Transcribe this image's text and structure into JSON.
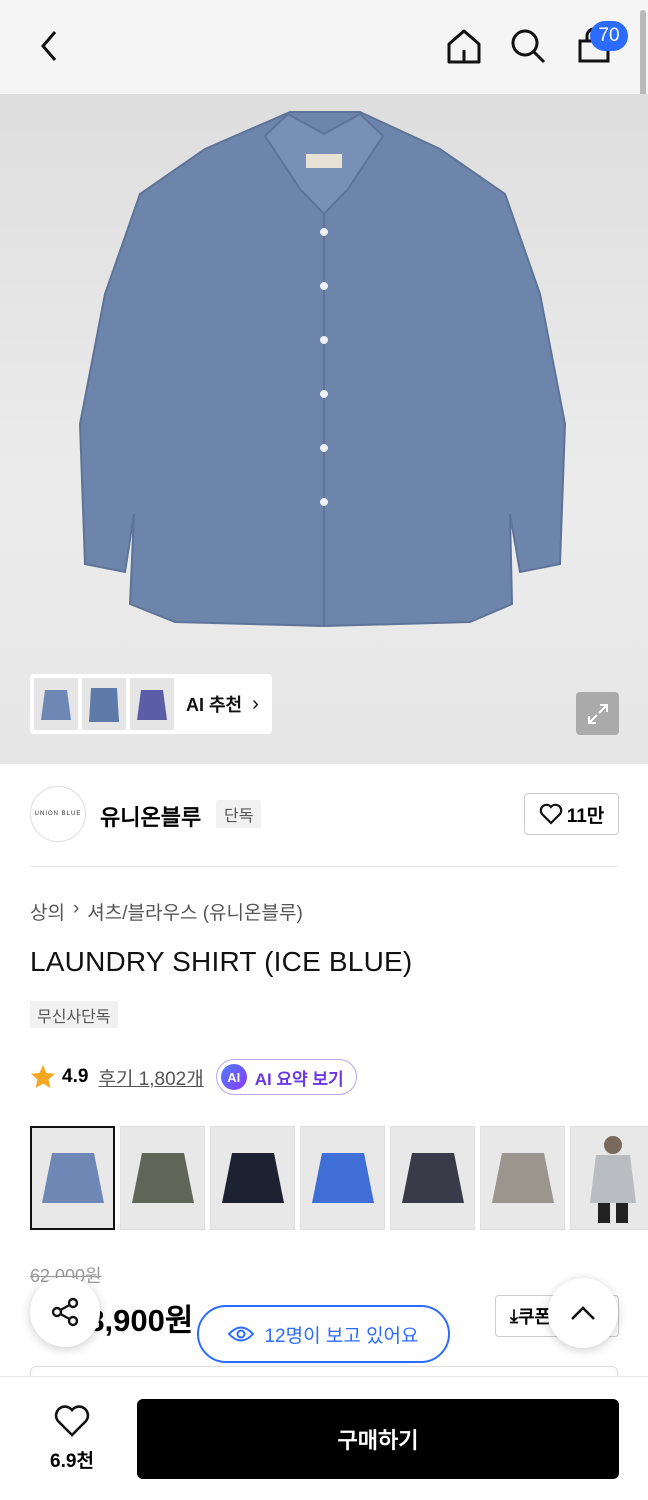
{
  "header": {
    "back_icon": "chevron-left-icon",
    "home_icon": "home-icon",
    "search_icon": "search-icon",
    "cart_icon": "shopping-bag-icon",
    "cart_count": "70",
    "badge_color": "#2c6bff"
  },
  "hero": {
    "product_color": "#6d84ab",
    "ai_recommend_label": "AI 추천",
    "expand_icon": "expand-icon"
  },
  "brand": {
    "logo_text": "UNION BLUE",
    "name": "유니온블루",
    "tag": "단독",
    "likes": "11만"
  },
  "product": {
    "breadcrumb": [
      "상의",
      "셔츠/블라우스 (유니온블루)"
    ],
    "title": "LAUNDRY SHIRT (ICE BLUE)",
    "tag": "무신사단독",
    "rating": "4.9",
    "review_label": "후기 1,802개",
    "ai_badge": "AI",
    "ai_summary_label": "AI 요약 보기"
  },
  "swatches": [
    {
      "color": "#6f87b4",
      "selected": true
    },
    {
      "color": "#5f6657",
      "selected": false
    },
    {
      "color": "#1d2233",
      "selected": false
    },
    {
      "color": "#3f6fd6",
      "selected": false
    },
    {
      "color": "#3b3a48",
      "selected": false
    },
    {
      "color": "#9a958d",
      "selected": false
    },
    {
      "color": "#b9bcc0",
      "selected": false
    }
  ],
  "price": {
    "original": "62,000원",
    "current": "58,900원",
    "coupon_label": "쿠폰"
  },
  "viewers": {
    "label": "12명이 보고 있어요"
  },
  "bottom_bar": {
    "wish_count": "6.9천",
    "buy_label": "구매하기"
  }
}
